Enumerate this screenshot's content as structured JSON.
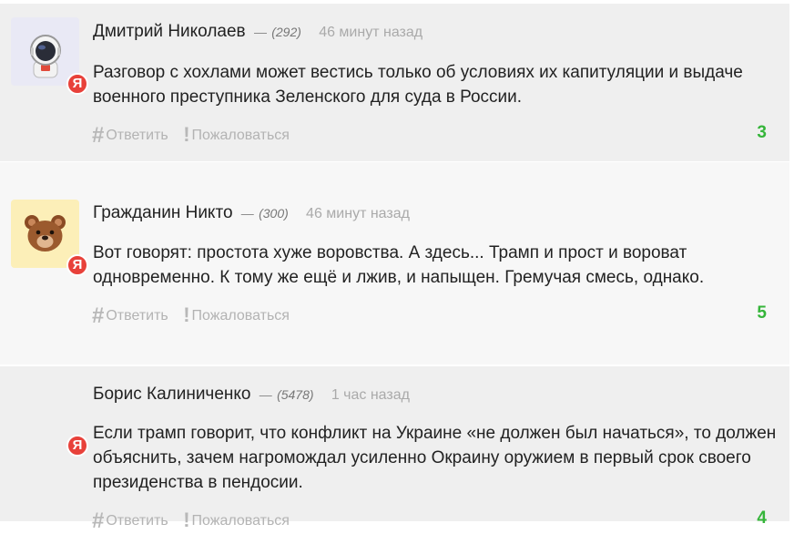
{
  "comments": [
    {
      "author": "Дмитрий Николаев",
      "dash": "—",
      "karma": "(292)",
      "time": "46 минут назад",
      "badge": "Я",
      "text": "Разговор с хохлами может вестись только об условиях их капитуляции и выдаче военного преступника Зеленского для суда в России.",
      "reply_label": "Ответить",
      "report_label": "Пожаловаться",
      "rating": "3",
      "avatar": "astronaut-icon"
    },
    {
      "author": "Гражданин Никто",
      "dash": "—",
      "karma": "(300)",
      "time": "46 минут назад",
      "badge": "Я",
      "text": "Вот говорят:  простота хуже воровства.  А здесь...  Трамп и прост и вороват одновременно. К тому же ещё и лжив, и напыщен.  Гремучая смесь, однако.",
      "reply_label": "Ответить",
      "report_label": "Пожаловаться",
      "rating": "5",
      "avatar": "bear-icon"
    },
    {
      "author": "Борис Калиниченко",
      "dash": "—",
      "karma": "(5478)",
      "time": "1 час назад",
      "badge": "Я",
      "text": "Если трамп говорит, что конфликт на Украине «не должен был начаться», то должен объяснить, зачем нагромождал усиленно Окраину оружием в первый срок своего президенства в пендосии.",
      "reply_label": "Ответить",
      "report_label": "Пожаловаться",
      "rating": "4",
      "avatar": ""
    }
  ],
  "colors": {
    "rating": "#35b53a",
    "badge": "#e8413a",
    "muted": "#b3b3b3"
  }
}
